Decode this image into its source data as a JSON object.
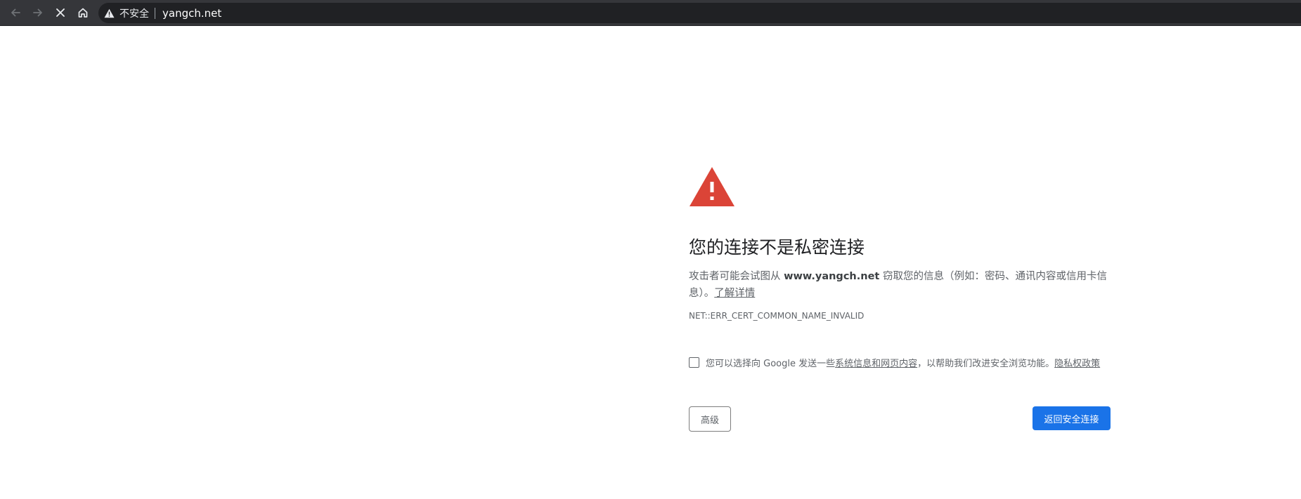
{
  "browser": {
    "security_label": "不安全",
    "url": "yangch.net",
    "icons": {
      "back": "arrow-left-icon",
      "forward": "arrow-right-icon",
      "stop": "close-icon",
      "home": "home-icon",
      "security": "warning-triangle-icon"
    }
  },
  "interstitial": {
    "heading": "您的连接不是私密连接",
    "explanation_prefix": "攻击者可能会试图从",
    "site": "www.yangch.net",
    "explanation_suffix": "窃取您的信息（例如：密码、通讯内容或信用卡信息）。",
    "learn_more": "了解详情",
    "error_code": "NET::ERR_CERT_COMMON_NAME_INVALID",
    "optin": {
      "prefix": "您可以选择向 Google 发送一些",
      "link": "系统信息和网页内容",
      "middle": "，以帮助我们改进安全浏览功能。",
      "privacy_link": "隐私权政策",
      "checked": false
    },
    "advanced_button": "高级",
    "back_button": "返回安全连接"
  },
  "colors": {
    "toolbar_bg": "#35363a",
    "omnibox_bg": "#202124",
    "warning_red": "#db4437",
    "primary_blue": "#1a73e8",
    "text_dark": "#202124",
    "text_gray": "#5f6368"
  }
}
